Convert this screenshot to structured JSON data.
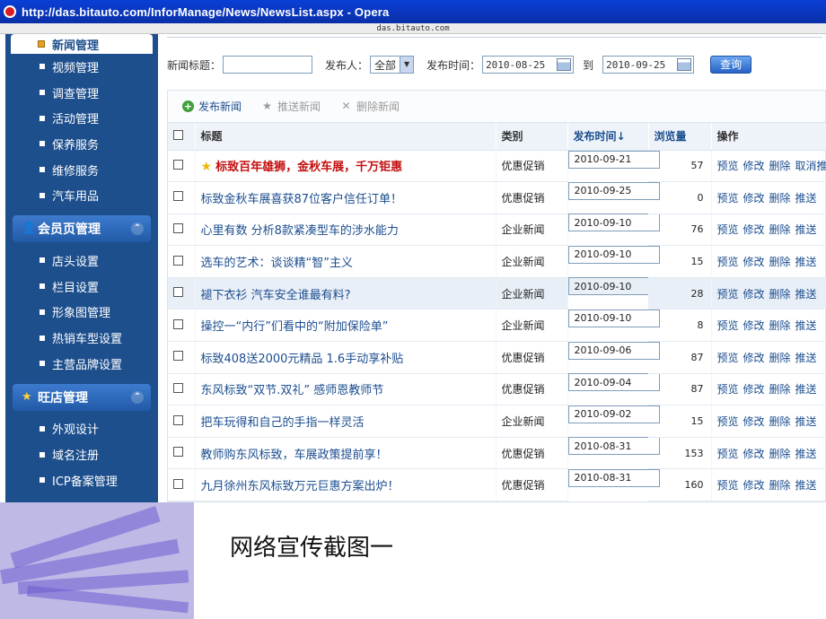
{
  "window": {
    "title": "http://das.bitauto.com/InforManage/News/NewsList.aspx - Opera",
    "address": "das.bitauto.com"
  },
  "sidebar": {
    "top_items": [
      {
        "label": "新闻管理",
        "active": true
      },
      {
        "label": "视频管理"
      },
      {
        "label": "调查管理"
      },
      {
        "label": "活动管理"
      },
      {
        "label": "保养服务"
      },
      {
        "label": "维修服务"
      },
      {
        "label": "汽车用品"
      }
    ],
    "sections": [
      {
        "title": "会员页管理",
        "items": [
          "店头设置",
          "栏目设置",
          "形象图管理",
          "热销车型设置",
          "主营品牌设置"
        ]
      },
      {
        "title": "旺店管理",
        "items": [
          "外观设计",
          "域名注册",
          "ICP备案管理"
        ]
      }
    ]
  },
  "filter": {
    "title_label": "新闻标题：",
    "title_value": "",
    "publisher_label": "发布人：",
    "publisher_value": "全部",
    "time_label": "发布时间：",
    "date_from": "2010-08-25",
    "to_label": "到",
    "date_to": "2010-09-25",
    "query_button": "查询"
  },
  "toolbar": {
    "publish": "发布新闻",
    "push": "推送新闻",
    "delete": "删除新闻"
  },
  "table": {
    "headers": {
      "title": "标题",
      "category": "类别",
      "time": "发布时间↓",
      "views": "浏览量",
      "ops": "操作"
    },
    "ops_labels": {
      "preview": "预览",
      "edit": "修改",
      "delete": "删除"
    },
    "rows": [
      {
        "title": "标致百年雄狮，金秋车展，千万钜惠",
        "category": "优惠促销",
        "date": "2010-09-21",
        "views": "57",
        "push": "取消推送",
        "featured": true
      },
      {
        "title": "标致金秋车展喜获87位客户信任订单！",
        "category": "优惠促销",
        "date": "2010-09-25",
        "views": "0",
        "push": "推送"
      },
      {
        "title": "心里有数 分析8款紧凑型车的涉水能力",
        "category": "企业新闻",
        "date": "2010-09-10",
        "views": "76",
        "push": "推送"
      },
      {
        "title": "选车的艺术：谈谈精“智”主义",
        "category": "企业新闻",
        "date": "2010-09-10",
        "views": "15",
        "push": "推送"
      },
      {
        "title": "褪下衣衫 汽车安全谁最有料?",
        "category": "企业新闻",
        "date": "2010-09-10",
        "views": "28",
        "push": "推送",
        "highlight": true
      },
      {
        "title": "操控一“内行”们看中的“附加保险单”",
        "category": "企业新闻",
        "date": "2010-09-10",
        "views": "8",
        "push": "推送"
      },
      {
        "title": "标致408送2000元精品 1.6手动享补贴",
        "category": "优惠促销",
        "date": "2010-09-06",
        "views": "87",
        "push": "推送"
      },
      {
        "title": "东风标致“双节.双礼” 感师恩教师节",
        "category": "优惠促销",
        "date": "2010-09-04",
        "views": "87",
        "push": "推送"
      },
      {
        "title": "把车玩得和自己的手指一样灵活",
        "category": "企业新闻",
        "date": "2010-09-02",
        "views": "15",
        "push": "推送"
      },
      {
        "title": "教师购东风标致，车展政策提前享！",
        "category": "优惠促销",
        "date": "2010-08-31",
        "views": "153",
        "push": "推送"
      },
      {
        "title": "九月徐州东风标致万元巨惠方案出炉！",
        "category": "优惠促销",
        "date": "2010-08-31",
        "views": "160",
        "push": "推送"
      }
    ]
  },
  "slide": {
    "caption": "网络宣传截图一"
  }
}
